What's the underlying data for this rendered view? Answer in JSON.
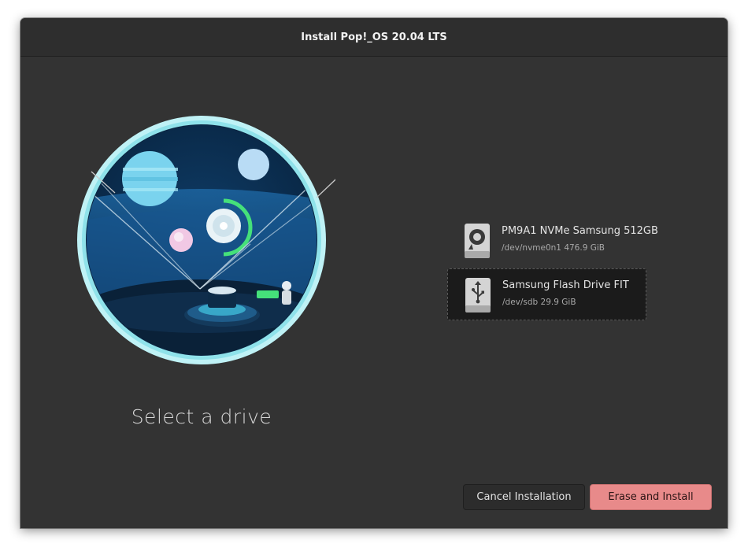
{
  "window": {
    "title": "Install Pop!_OS 20.04 LTS"
  },
  "main": {
    "heading": "Select a drive",
    "illustration": "space-observatory-illustration"
  },
  "drives": [
    {
      "name": "PM9A1 NVMe Samsung 512GB",
      "device": "/dev/nvme0n1",
      "size": "476.9 GiB",
      "subtitle": "/dev/nvme0n1 476.9 GiB",
      "icon": "hard-drive-icon",
      "selected": false
    },
    {
      "name": "Samsung Flash Drive FIT",
      "device": "/dev/sdb",
      "size": "29.9 GiB",
      "subtitle": "/dev/sdb 29.9 GiB",
      "icon": "usb-drive-icon",
      "selected": true
    }
  ],
  "buttons": {
    "cancel_label": "Cancel Installation",
    "erase_label": "Erase and Install"
  },
  "colors": {
    "window_bg": "#333333",
    "titlebar_bg": "#2e2e2e",
    "destructive": "#e88a8a",
    "accent_cyan": "#9ee9f0",
    "accent_green": "#45e07a"
  }
}
